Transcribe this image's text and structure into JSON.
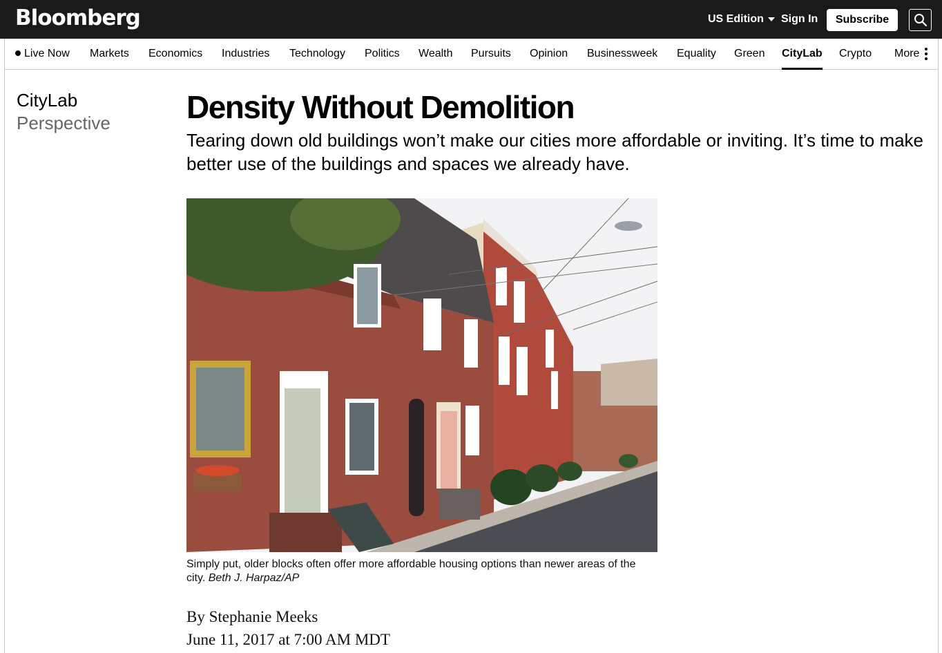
{
  "header": {
    "logo": "Bloomberg",
    "edition": "US Edition",
    "sign_in": "Sign In",
    "subscribe": "Subscribe"
  },
  "nav": {
    "live": "Live Now",
    "items": [
      "Markets",
      "Economics",
      "Industries",
      "Technology",
      "Politics",
      "Wealth",
      "Pursuits",
      "Opinion",
      "Businessweek",
      "Equality",
      "Green",
      "CityLab",
      "Crypto"
    ],
    "active": "CityLab",
    "more": "More"
  },
  "rail": {
    "vertical": "CityLab",
    "type": "Perspective"
  },
  "article": {
    "headline": "Density Without Demolition",
    "dek": "Tearing down old buildings won’t make our cities more affordable or inviting. It’s time to make better use of the buildings and spaces we already have.",
    "caption": "Simply put, older blocks often offer more affordable housing options than newer areas of the city.",
    "credit": "Beth J. Harpaz/AP",
    "byline": "By Stephanie Meeks",
    "date": "June 11, 2017 at 7:00 AM MDT"
  }
}
